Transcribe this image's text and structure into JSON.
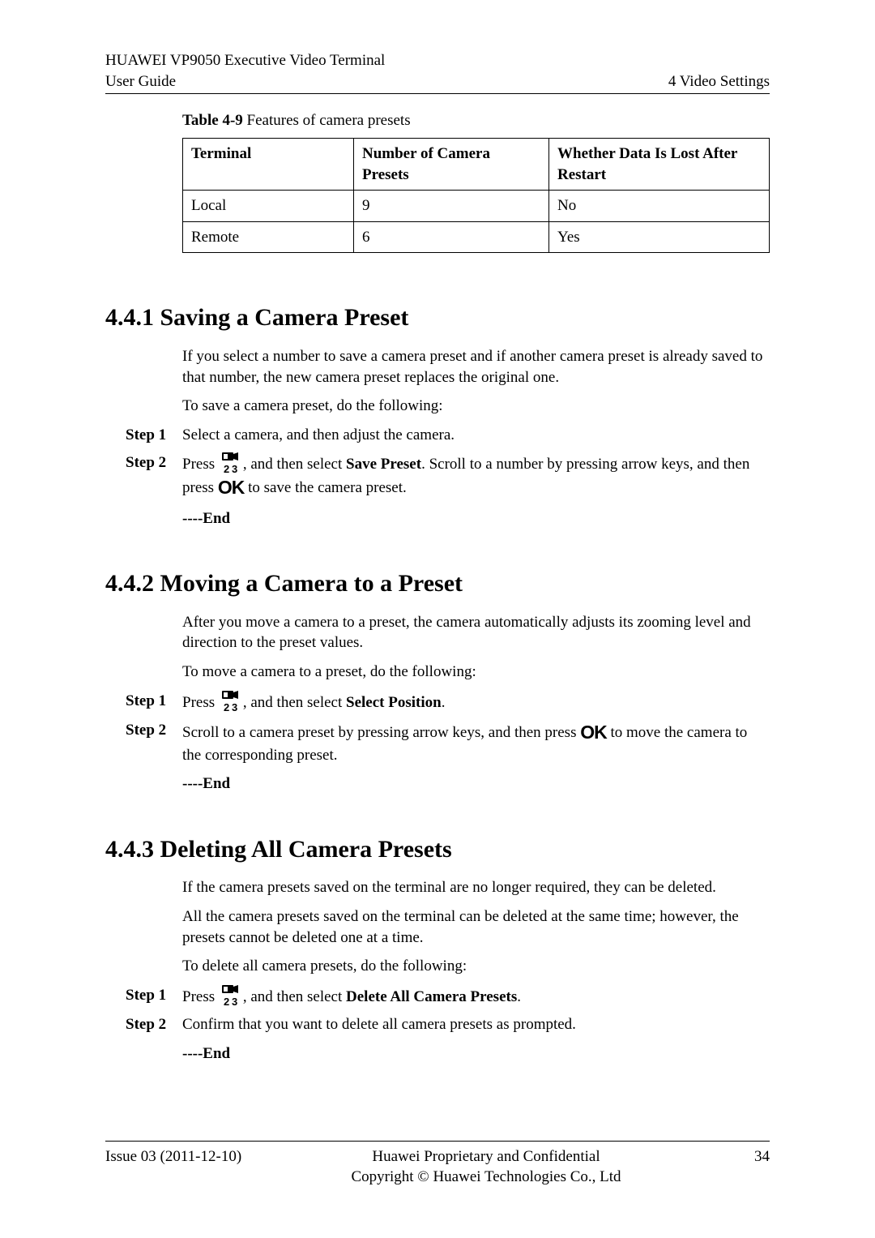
{
  "header": {
    "product_line1": "HUAWEI VP9050 Executive Video Terminal",
    "product_line2": "User Guide",
    "chapter": "4 Video Settings"
  },
  "table": {
    "caption_label": "Table 4-9",
    "caption_text": " Features of camera presets",
    "h1": "Terminal",
    "h2": "Number of Camera Presets",
    "h3": "Whether Data Is Lost After Restart",
    "r1c1": "Local",
    "r1c2": "9",
    "r1c3": "No",
    "r2c1": "Remote",
    "r2c2": "6",
    "r2c3": "Yes"
  },
  "s441": {
    "heading": "4.4.1 Saving a Camera Preset",
    "p1": "If you select a number to save a camera preset and if another camera preset is already saved to that number, the new camera preset replaces the original one.",
    "p2": "To save a camera preset, do the following:",
    "step1_label": "Step 1",
    "step1_body": "Select a camera, and then adjust the camera.",
    "step2_label": "Step 2",
    "step2_a": "Press ",
    "step2_b": ", and then select ",
    "step2_bold1": "Save Preset",
    "step2_c": ". Scroll to a number by pressing arrow keys, and then press ",
    "step2_ok": "OK",
    "step2_d": " to save the camera preset.",
    "end": "----End"
  },
  "s442": {
    "heading": "4.4.2 Moving a Camera to a Preset",
    "p1": "After you move a camera to a preset, the camera automatically adjusts its zooming level and direction to the preset values.",
    "p2": "To move a camera to a preset, do the following:",
    "step1_label": "Step 1",
    "step1_a": "Press ",
    "step1_b": ", and then select ",
    "step1_bold": "Select Position",
    "step1_c": ".",
    "step2_label": "Step 2",
    "step2_a": "Scroll to a camera preset by pressing arrow keys, and then press ",
    "step2_ok": "OK",
    "step2_b": " to move the camera to the corresponding preset.",
    "end": "----End"
  },
  "s443": {
    "heading": "4.4.3 Deleting All Camera Presets",
    "p1": "If the camera presets saved on the terminal are no longer required, they can be deleted.",
    "p2": "All the camera presets saved on the terminal can be deleted at the same time; however, the presets cannot be deleted one at a time.",
    "p3": "To delete all camera presets, do the following:",
    "step1_label": "Step 1",
    "step1_a": "Press ",
    "step1_b": ", and then select ",
    "step1_bold": "Delete All Camera Presets",
    "step1_c": ".",
    "step2_label": "Step 2",
    "step2_body": "Confirm that you want to delete all camera presets as prompted.",
    "end": "----End"
  },
  "footer": {
    "issue": "Issue 03 (2011-12-10)",
    "center1": "Huawei Proprietary and Confidential",
    "center2": "Copyright © Huawei Technologies Co., Ltd",
    "page": "34"
  }
}
